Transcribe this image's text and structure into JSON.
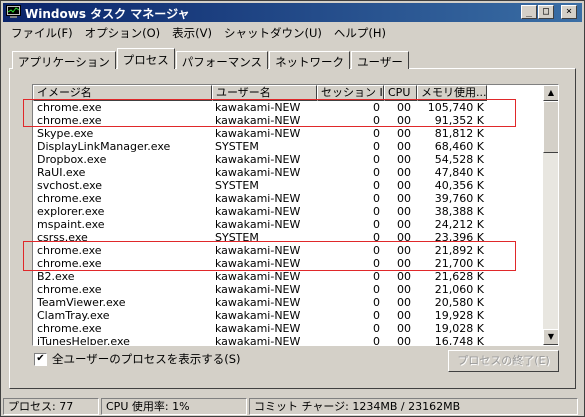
{
  "window": {
    "title": "Windows タスク マネージャ"
  },
  "menu": [
    "ファイル(F)",
    "オプション(O)",
    "表示(V)",
    "シャットダウン(U)",
    "ヘルプ(H)"
  ],
  "tabs": [
    "アプリケーション",
    "プロセス",
    "パフォーマンス",
    "ネットワーク",
    "ユーザー"
  ],
  "active_tab": "プロセス",
  "columns": [
    "イメージ名",
    "ユーザー名",
    "セッション ID",
    "CPU",
    "メモリ使用..."
  ],
  "processes": [
    [
      "chrome.exe",
      "kawakami-NEW",
      "0",
      "00",
      "105,740 K"
    ],
    [
      "chrome.exe",
      "kawakami-NEW",
      "0",
      "00",
      "91,352 K"
    ],
    [
      "Skype.exe",
      "kawakami-NEW",
      "0",
      "00",
      "81,812 K"
    ],
    [
      "DisplayLinkManager.exe",
      "SYSTEM",
      "0",
      "00",
      "68,460 K"
    ],
    [
      "Dropbox.exe",
      "kawakami-NEW",
      "0",
      "00",
      "54,528 K"
    ],
    [
      "RaUI.exe",
      "kawakami-NEW",
      "0",
      "00",
      "47,840 K"
    ],
    [
      "svchost.exe",
      "SYSTEM",
      "0",
      "00",
      "40,356 K"
    ],
    [
      "chrome.exe",
      "kawakami-NEW",
      "0",
      "00",
      "39,760 K"
    ],
    [
      "explorer.exe",
      "kawakami-NEW",
      "0",
      "00",
      "38,388 K"
    ],
    [
      "mspaint.exe",
      "kawakami-NEW",
      "0",
      "00",
      "24,212 K"
    ],
    [
      "csrss.exe",
      "SYSTEM",
      "0",
      "00",
      "23,396 K"
    ],
    [
      "chrome.exe",
      "kawakami-NEW",
      "0",
      "00",
      "21,892 K"
    ],
    [
      "chrome.exe",
      "kawakami-NEW",
      "0",
      "00",
      "21,700 K"
    ],
    [
      "B2.exe",
      "kawakami-NEW",
      "0",
      "00",
      "21,628 K"
    ],
    [
      "chrome.exe",
      "kawakami-NEW",
      "0",
      "00",
      "21,060 K"
    ],
    [
      "TeamViewer.exe",
      "kawakami-NEW",
      "0",
      "00",
      "20,580 K"
    ],
    [
      "ClamTray.exe",
      "kawakami-NEW",
      "0",
      "00",
      "19,928 K"
    ],
    [
      "chrome.exe",
      "kawakami-NEW",
      "0",
      "00",
      "19,028 K"
    ],
    [
      "iTunesHelper.exe",
      "kawakami-NEW",
      "0",
      "00",
      "16,748 K"
    ]
  ],
  "show_all_users": {
    "label": "全ユーザーのプロセスを表示する(S)",
    "checked": true
  },
  "end_process_button": "プロセスの終了(E)",
  "status": {
    "processes": "プロセス: 77",
    "cpu": "CPU 使用率: 1%",
    "commit": "コミット チャージ: 1234MB / 23162MB"
  },
  "highlight_color": "#e0282a"
}
